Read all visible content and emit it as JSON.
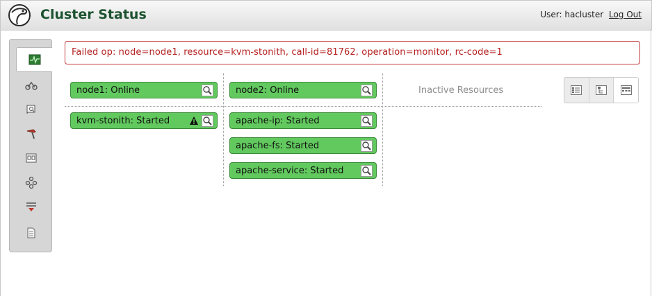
{
  "header": {
    "title": "Cluster Status",
    "user_label": "User: hacluster",
    "logout_label": "Log Out"
  },
  "sidebar": {
    "items": [
      {
        "icon": "dashboard-icon",
        "active": true
      },
      {
        "icon": "nodes-icon"
      },
      {
        "icon": "resources-icon"
      },
      {
        "icon": "tools-icon"
      },
      {
        "icon": "constraints-icon"
      },
      {
        "icon": "cluster-config-icon"
      },
      {
        "icon": "access-control-icon"
      },
      {
        "icon": "history-icon"
      }
    ]
  },
  "error": {
    "text": "Failed op: node=node1, resource=kvm-stonith, call-id=81762, operation=monitor, rc-code=1"
  },
  "nodes": [
    {
      "label": "node1: Online",
      "resources": [
        {
          "label": "kvm-stonith: Started",
          "warning": true
        }
      ]
    },
    {
      "label": "node2: Online",
      "resources": [
        {
          "label": "apache-ip: Started"
        },
        {
          "label": "apache-fs: Started"
        },
        {
          "label": "apache-service: Started"
        }
      ]
    }
  ],
  "inactive_label": "Inactive Resources",
  "views": [
    "list-view-icon",
    "tree-view-icon",
    "grid-view-icon"
  ],
  "colors": {
    "status_green": "#62c95e",
    "error_red": "#b52020",
    "title_green": "#1c5230"
  }
}
